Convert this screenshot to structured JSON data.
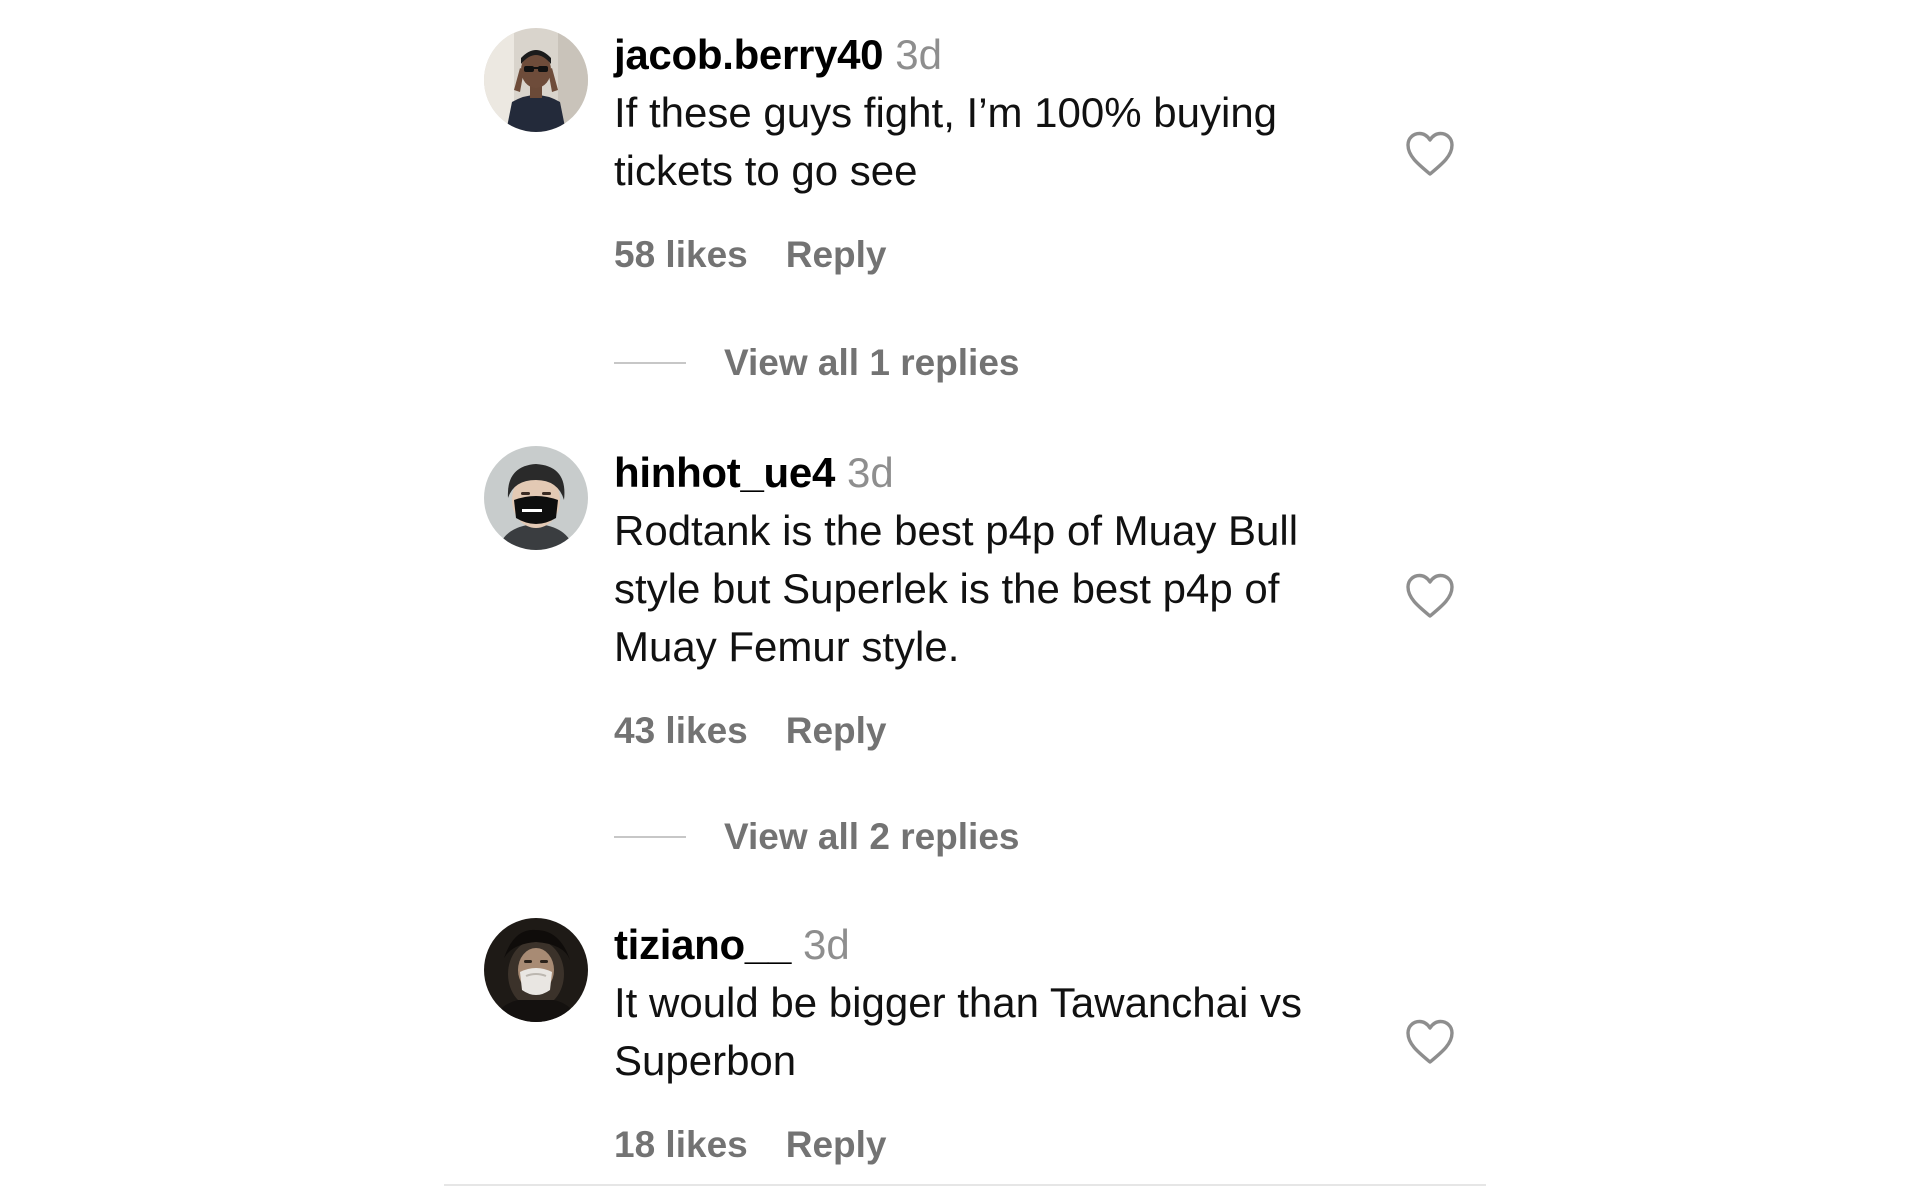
{
  "comments": [
    {
      "username": "jacob.berry40",
      "time": "3d",
      "text": "If these guys fight, I’m 100% buying tickets to go see",
      "likes": "58 likes",
      "reply_label": "Reply",
      "view_replies": "View all 1 replies",
      "avatar_icon": "person-sunglasses-avatar-icon"
    },
    {
      "username": "hinhot_ue4",
      "time": "3d",
      "text": "Rodtank is the best p4p of Muay Bull style but Superlek is the best p4p of Muay Femur style.",
      "likes": "43 likes",
      "reply_label": "Reply",
      "view_replies": "View all 2 replies",
      "avatar_icon": "person-mask-avatar-icon"
    },
    {
      "username": "tiziano__",
      "time": "3d",
      "text": "It would be bigger than Tawanchai vs Superbon",
      "likes": "18 likes",
      "reply_label": "Reply",
      "avatar_icon": "person-mask-dark-avatar-icon"
    }
  ],
  "icons": {
    "like": "heart-outline-icon"
  },
  "colors": {
    "text": "#000000",
    "muted": "#737373",
    "timestamp": "#8e8e8e",
    "divider": "#c7c7c7"
  }
}
